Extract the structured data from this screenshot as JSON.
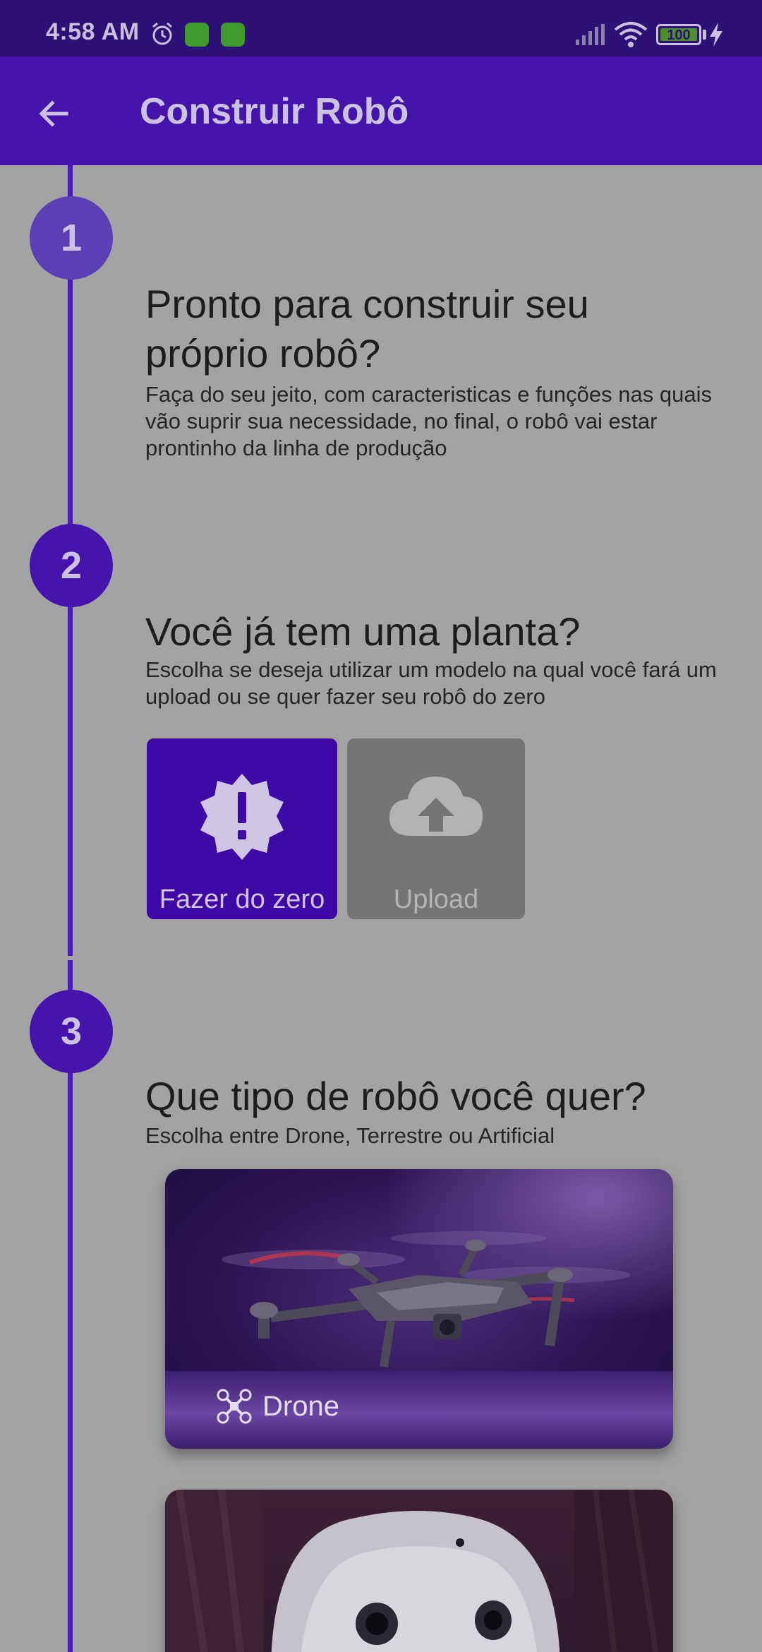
{
  "status_bar": {
    "time": "4:58 AM",
    "battery": "100",
    "icons": [
      "alarm-icon",
      "app-badge-icon",
      "app-badge-icon",
      "signal-icon",
      "wifi-icon",
      "battery-icon",
      "charging-bolt-icon"
    ]
  },
  "app_bar": {
    "title": "Construir Robô",
    "back_icon": "arrow-back-icon"
  },
  "steps": [
    {
      "number": "1",
      "title_line1": "Pronto para construir seu",
      "title_line2": "próprio robô?",
      "description": "Faça do seu jeito, com caracteristicas e funções nas quais vão suprir sua necessidade, no final, o robô vai estar prontinho da linha de produção"
    },
    {
      "number": "2",
      "title": "Você já tem uma planta?",
      "description": "Escolha se deseja utilizar um modelo na qual você fará um upload ou se quer fazer seu robô do zero",
      "options": [
        {
          "label": "Fazer do zero",
          "icon": "new-badge-icon",
          "selected": true
        },
        {
          "label": "Upload",
          "icon": "cloud-upload-icon",
          "selected": false
        }
      ]
    },
    {
      "number": "3",
      "title": "Que tipo de robô você quer?",
      "description": "Escolha entre Drone, Terrestre ou Artificial",
      "cards": [
        {
          "label": "Drone",
          "icon": "drone-icon"
        },
        {
          "label": "",
          "icon": "humanoid-robot-image"
        }
      ]
    }
  ],
  "colors": {
    "primary": "#4514ad",
    "status_bar": "#2d1177",
    "selected_option": "#3f08a6",
    "unselected_option": "#757575",
    "background": "#a3a3a3"
  }
}
